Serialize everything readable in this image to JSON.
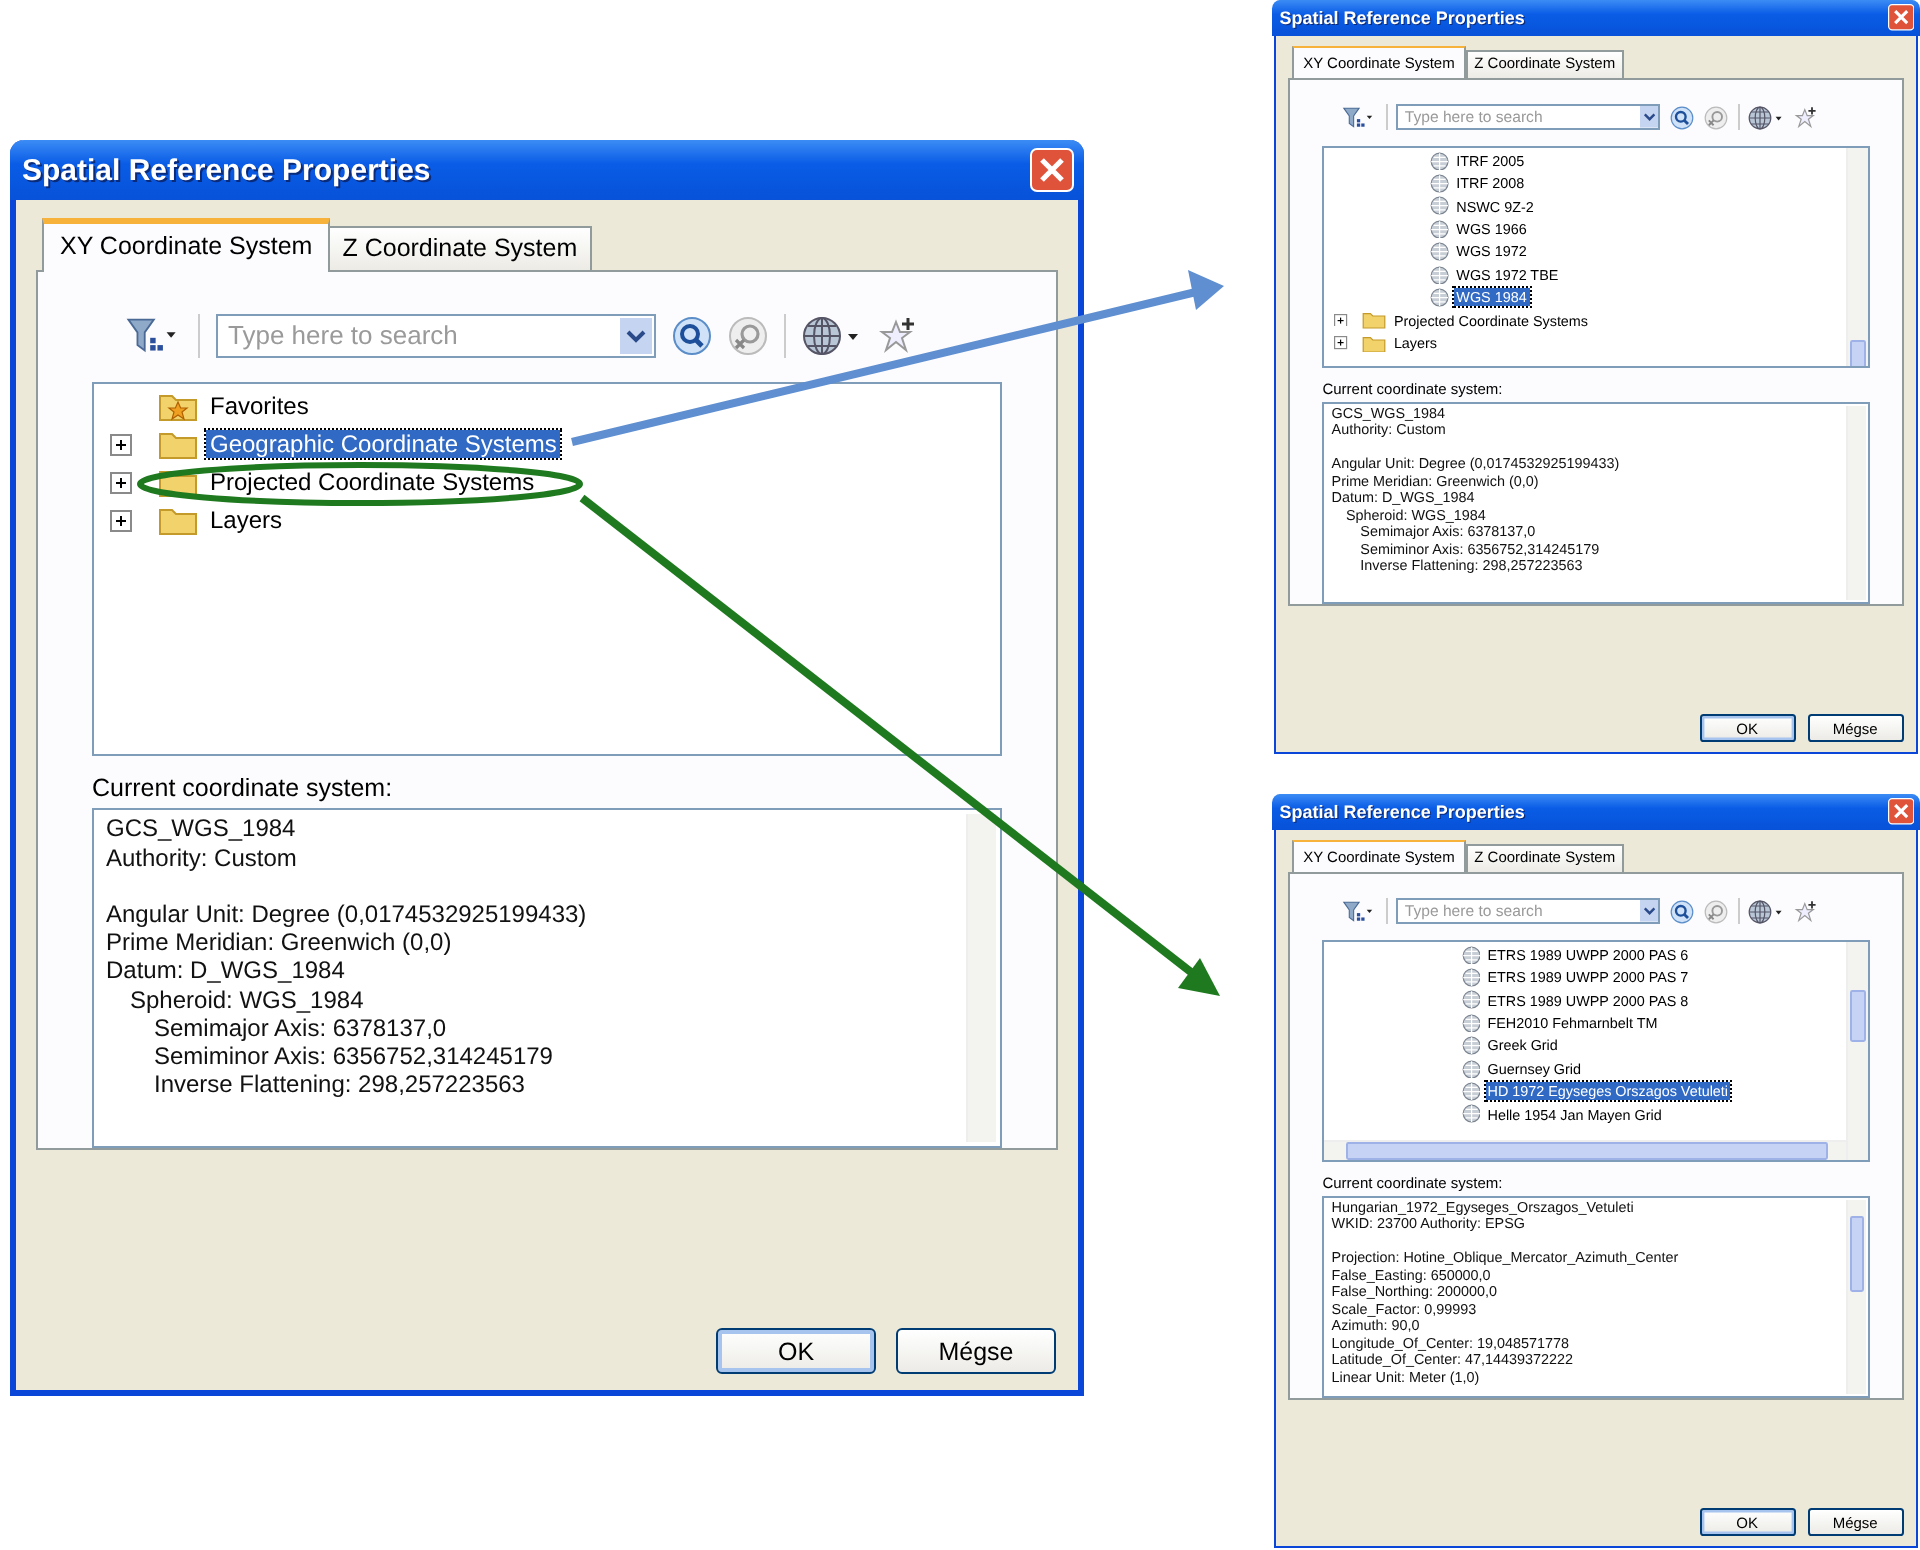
{
  "windows": [
    {
      "title": "Spatial Reference Properties",
      "tabs": [
        {
          "label": "XY Coordinate System",
          "selected": true
        },
        {
          "label": "Z Coordinate System",
          "selected": false
        }
      ],
      "search": {
        "placeholder": "Type here to search"
      },
      "tree": [
        {
          "kind": "favorites",
          "label": "Favorites",
          "selected": false
        },
        {
          "kind": "folder",
          "label": "Geographic Coordinate Systems",
          "expanded": false,
          "selected": true
        },
        {
          "kind": "folder",
          "label": "Projected Coordinate Systems",
          "expanded": false,
          "selected": false
        },
        {
          "kind": "folder",
          "label": "Layers",
          "expanded": false,
          "selected": false
        }
      ],
      "info_label": "Current coordinate system:",
      "info": [
        {
          "lines": [
            {
              "text": "GCS_WGS_1984"
            },
            {
              "text": "Authority: Custom"
            }
          ]
        },
        {
          "lines": [
            {
              "text": "Angular Unit: Degree (0,0174532925199433)"
            },
            {
              "text": "Prime Meridian: Greenwich (0,0)"
            },
            {
              "text": "Datum: D_WGS_1984",
              "children": [
                {
                  "text": "Spheroid: WGS_1984",
                  "children": [
                    {
                      "text": "Semimajor Axis: 6378137,0"
                    },
                    {
                      "text": "Semiminor Axis: 6356752,314245179"
                    },
                    {
                      "text": "Inverse Flattening: 298,257223563"
                    }
                  ]
                }
              ]
            }
          ]
        }
      ],
      "buttons": [
        {
          "label": "OK",
          "default": true
        },
        {
          "label": "Mégse",
          "default": false
        }
      ]
    },
    {
      "title": "Spatial Reference Properties",
      "tabs": [
        {
          "label": "XY Coordinate System",
          "selected": true
        },
        {
          "label": "Z Coordinate System",
          "selected": false
        }
      ],
      "search": {
        "placeholder": "Type here to search"
      },
      "tree": [
        {
          "kind": "coordsys",
          "label": "ITRF 2005",
          "selected": false
        },
        {
          "kind": "coordsys",
          "label": "ITRF 2008",
          "selected": false
        },
        {
          "kind": "coordsys",
          "label": "NSWC 9Z-2",
          "selected": false
        },
        {
          "kind": "coordsys",
          "label": "WGS 1966",
          "selected": false
        },
        {
          "kind": "coordsys",
          "label": "WGS 1972",
          "selected": false
        },
        {
          "kind": "coordsys",
          "label": "WGS 1972 TBE",
          "selected": false
        },
        {
          "kind": "coordsys",
          "label": "WGS 1984",
          "selected": true
        },
        {
          "kind": "folder",
          "label": "Projected Coordinate Systems",
          "expanded": false,
          "selected": false
        },
        {
          "kind": "folder",
          "label": "Layers",
          "expanded": false,
          "selected": false
        }
      ],
      "info_label": "Current coordinate system:",
      "info": [
        {
          "lines": [
            {
              "text": "GCS_WGS_1984"
            },
            {
              "text": "Authority: Custom"
            }
          ]
        },
        {
          "lines": [
            {
              "text": "Angular Unit: Degree (0,0174532925199433)"
            },
            {
              "text": "Prime Meridian: Greenwich (0,0)"
            },
            {
              "text": "Datum: D_WGS_1984",
              "children": [
                {
                  "text": "Spheroid: WGS_1984",
                  "children": [
                    {
                      "text": "Semimajor Axis: 6378137,0"
                    },
                    {
                      "text": "Semiminor Axis: 6356752,314245179"
                    },
                    {
                      "text": "Inverse Flattening: 298,257223563"
                    }
                  ]
                }
              ]
            }
          ]
        }
      ],
      "buttons": [
        {
          "label": "OK",
          "default": true
        },
        {
          "label": "Mégse",
          "default": false
        }
      ]
    },
    {
      "title": "Spatial Reference Properties",
      "tabs": [
        {
          "label": "XY Coordinate System",
          "selected": true
        },
        {
          "label": "Z Coordinate System",
          "selected": false
        }
      ],
      "search": {
        "placeholder": "Type here to search"
      },
      "tree": [
        {
          "kind": "projsys",
          "label": "ETRS 1989 UWPP 2000 PAS 6",
          "selected": false
        },
        {
          "kind": "projsys",
          "label": "ETRS 1989 UWPP 2000 PAS 7",
          "selected": false
        },
        {
          "kind": "projsys",
          "label": "ETRS 1989 UWPP 2000 PAS 8",
          "selected": false
        },
        {
          "kind": "projsys",
          "label": "FEH2010 Fehmarnbelt TM",
          "selected": false
        },
        {
          "kind": "projsys",
          "label": "Greek Grid",
          "selected": false
        },
        {
          "kind": "projsys",
          "label": "Guernsey Grid",
          "selected": false
        },
        {
          "kind": "projsys",
          "label": "HD 1972 Egyseges Orszagos Vetuleti",
          "selected": true
        },
        {
          "kind": "projsys",
          "label": "Helle 1954 Jan Mayen Grid",
          "selected": false
        }
      ],
      "info_label": "Current coordinate system:",
      "info": [
        {
          "lines": [
            {
              "text": "Hungarian_1972_Egyseges_Orszagos_Vetuleti"
            },
            {
              "text": "WKID: 23700 Authority: EPSG"
            }
          ]
        },
        {
          "lines": [
            {
              "text": "Projection: Hotine_Oblique_Mercator_Azimuth_Center"
            },
            {
              "text": "False_Easting: 650000,0"
            },
            {
              "text": "False_Northing: 200000,0"
            },
            {
              "text": "Scale_Factor: 0,99993"
            },
            {
              "text": "Azimuth: 90,0"
            },
            {
              "text": "Longitude_Of_Center: 19,048571778"
            },
            {
              "text": "Latitude_Of_Center: 47,14439372222"
            },
            {
              "text": "Linear Unit: Meter (1,0)"
            }
          ]
        }
      ],
      "buttons": [
        {
          "label": "OK",
          "default": true
        },
        {
          "label": "Mégse",
          "default": false
        }
      ]
    }
  ]
}
